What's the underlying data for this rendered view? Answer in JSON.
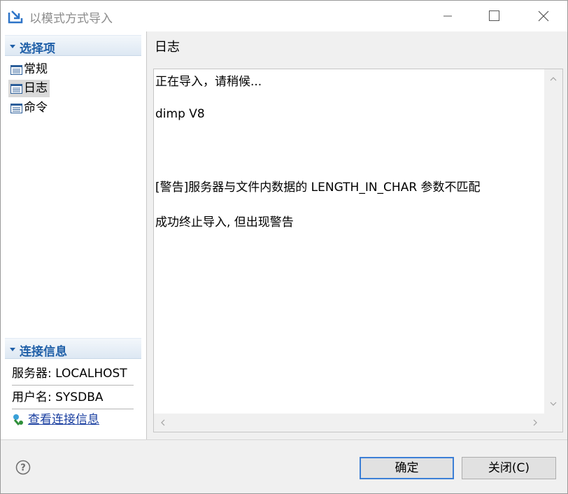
{
  "window": {
    "title": "以模式方式导入"
  },
  "left": {
    "options_header": "选择项",
    "nav_items": [
      {
        "label": "常规",
        "selected": false
      },
      {
        "label": "日志",
        "selected": true
      },
      {
        "label": "命令",
        "selected": false
      }
    ],
    "connection_header": "连接信息",
    "server": "服务器: LOCALHOST",
    "user": "用户名: SYSDBA",
    "view_link": "查看连接信息"
  },
  "right": {
    "header": "日志",
    "log_lines": [
      "正在导入，请稍候...",
      "dimp V8",
      "[警告]服务器与文件内数据的 LENGTH_IN_CHAR 参数不匹配",
      "成功终止导入, 但出现警告"
    ]
  },
  "buttons": {
    "ok": "确定",
    "close": "关闭(C)"
  },
  "colors": {
    "accent": "#1f5fa8",
    "link": "#1a3fa0",
    "default_button_border": "#3c7fd6"
  },
  "icons": [
    "import-app-icon",
    "minimize-icon",
    "maximize-icon",
    "close-icon",
    "chevron-down-icon",
    "list-page-icon",
    "connection-info-icon",
    "help-icon",
    "scroll-up-icon",
    "scroll-down-icon",
    "scroll-left-icon",
    "scroll-right-icon"
  ]
}
